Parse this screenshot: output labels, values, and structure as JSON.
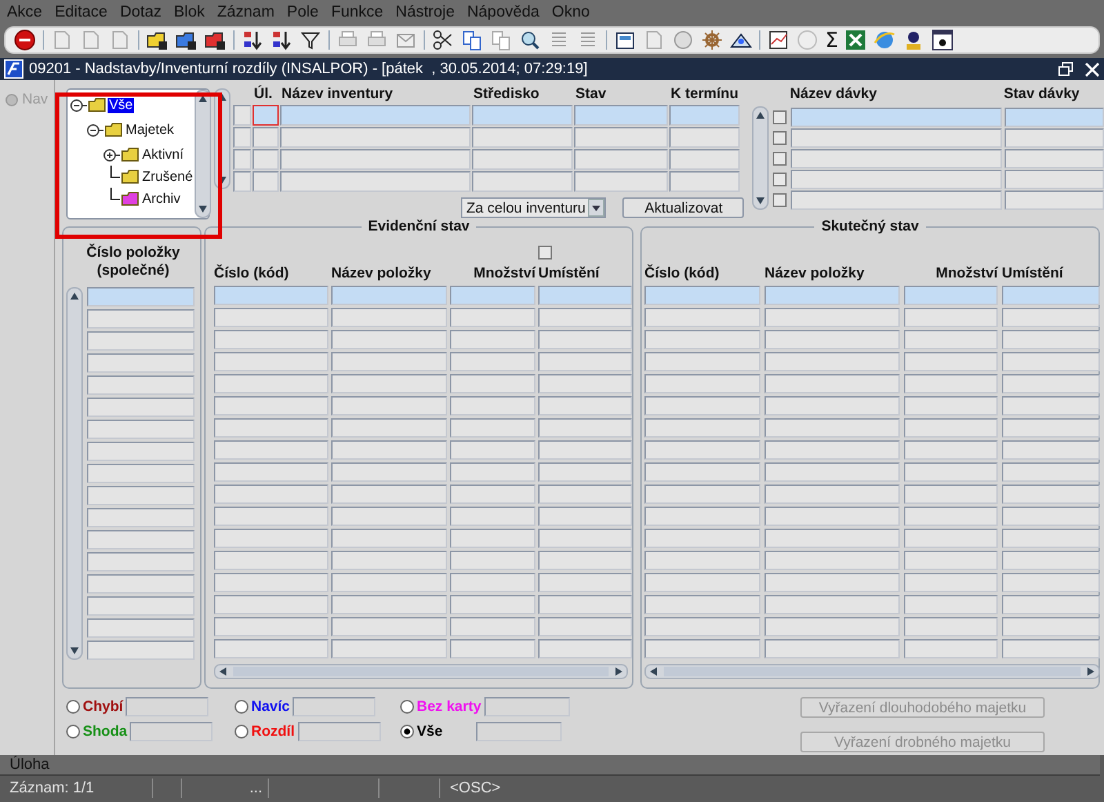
{
  "menu": [
    {
      "label": "Akce"
    },
    {
      "label": "Editace"
    },
    {
      "label": "Dotaz"
    },
    {
      "label": "Blok"
    },
    {
      "label": "Záznam"
    },
    {
      "label": "Pole"
    },
    {
      "label": "Funkce"
    },
    {
      "label": "Nástroje"
    },
    {
      "label": "Nápověda"
    },
    {
      "label": "Okno"
    }
  ],
  "toolbar": {
    "sum_symbol": "Σ"
  },
  "window": {
    "title": "09201 - Nadstavby/Inventurní rozdíly (INSALPOR) - [pátek  , 30.05.2014; 07:29:19]"
  },
  "nav": {
    "label": "Nav"
  },
  "tree": {
    "items": [
      {
        "label": "Vše",
        "selected": true,
        "expanded": true,
        "color": "#e8d040",
        "children": [
          {
            "label": "Majetek",
            "selected": false,
            "expanded": true,
            "color": "#e8d040",
            "children": [
              {
                "label": "Aktivní",
                "selected": false,
                "expanded": false,
                "color": "#e8d040"
              },
              {
                "label": "Zrušené",
                "selected": false,
                "color": "#e8d040"
              },
              {
                "label": "Archiv",
                "selected": false,
                "color": "#e040e0"
              }
            ]
          }
        ]
      }
    ]
  },
  "inventory_grid": {
    "columns": [
      "Úl.",
      "Název inventury",
      "Středisko",
      "Stav",
      "K termínu"
    ],
    "rows": [
      {
        "selected": true,
        "focused": true
      },
      {
        "selected": false,
        "focused": false
      },
      {
        "selected": false,
        "focused": false
      },
      {
        "selected": false,
        "focused": false
      }
    ]
  },
  "scope_select": {
    "value": "Za celou inventuru"
  },
  "update_button": {
    "label": "Aktualizovat"
  },
  "batch_grid": {
    "columns": [
      "Název dávky",
      "Stav dávky"
    ],
    "rows": [
      {
        "selected": true,
        "checked": false
      },
      {
        "selected": false,
        "checked": false
      },
      {
        "selected": false,
        "checked": false
      },
      {
        "selected": false,
        "checked": false
      },
      {
        "selected": false,
        "checked": false
      }
    ]
  },
  "common_panel": {
    "heading": "Číslo položky (společné)",
    "rows": [
      {
        "selected": true
      },
      {
        "selected": false
      },
      {
        "selected": false
      },
      {
        "selected": false
      },
      {
        "selected": false
      },
      {
        "selected": false
      },
      {
        "selected": false
      },
      {
        "selected": false
      },
      {
        "selected": false
      },
      {
        "selected": false
      },
      {
        "selected": false
      },
      {
        "selected": false
      },
      {
        "selected": false
      },
      {
        "selected": false
      },
      {
        "selected": false
      },
      {
        "selected": false
      },
      {
        "selected": false
      }
    ]
  },
  "evidence_panel": {
    "title": "Evidenční stav",
    "quantity_checked": false,
    "columns": [
      "Číslo (kód)",
      "Název položky",
      "Množství",
      "Umístění"
    ],
    "rows": [
      {
        "selected": true
      },
      {
        "selected": false
      },
      {
        "selected": false
      },
      {
        "selected": false
      },
      {
        "selected": false
      },
      {
        "selected": false
      },
      {
        "selected": false
      },
      {
        "selected": false
      },
      {
        "selected": false
      },
      {
        "selected": false
      },
      {
        "selected": false
      },
      {
        "selected": false
      },
      {
        "selected": false
      },
      {
        "selected": false
      },
      {
        "selected": false
      },
      {
        "selected": false
      },
      {
        "selected": false
      }
    ]
  },
  "actual_panel": {
    "title": "Skutečný stav",
    "columns": [
      "Číslo (kód)",
      "Název položky",
      "Množství",
      "Umístění"
    ],
    "rows": [
      {
        "selected": true
      },
      {
        "selected": false
      },
      {
        "selected": false
      },
      {
        "selected": false
      },
      {
        "selected": false
      },
      {
        "selected": false
      },
      {
        "selected": false
      },
      {
        "selected": false
      },
      {
        "selected": false
      },
      {
        "selected": false
      },
      {
        "selected": false
      },
      {
        "selected": false
      },
      {
        "selected": false
      },
      {
        "selected": false
      },
      {
        "selected": false
      },
      {
        "selected": false
      },
      {
        "selected": false
      }
    ]
  },
  "filters": [
    {
      "label": "Chybí",
      "color": "#a01010",
      "selected": false
    },
    {
      "label": "Shoda",
      "color": "#169016",
      "selected": false
    },
    {
      "label": "Navíc",
      "color": "#1010f0",
      "selected": false
    },
    {
      "label": "Rozdíl",
      "color": "#f01010",
      "selected": false
    },
    {
      "label": "Bez karty",
      "color": "#f010f0",
      "selected": false
    },
    {
      "label": "Vše",
      "color": "#000000",
      "selected": true
    }
  ],
  "actions": [
    {
      "label": "Vyřazení dlouhodobého majetku",
      "disabled": true
    },
    {
      "label": "Vyřazení drobného majetku",
      "disabled": true
    }
  ],
  "status_bar": {
    "message": "Úloha",
    "record": "Záznam: 1/1",
    "more": "...",
    "mode": "<OSC>"
  }
}
